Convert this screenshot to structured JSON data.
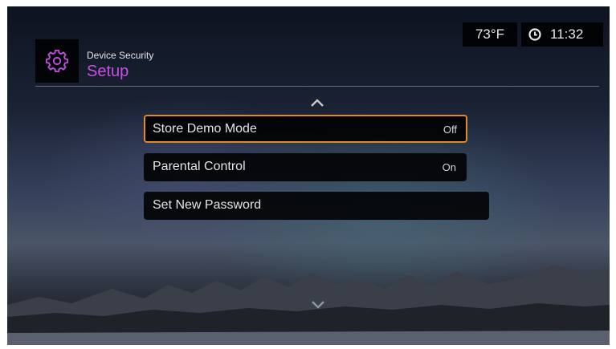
{
  "status": {
    "temperature": "73°F",
    "time": "11:32"
  },
  "header": {
    "subtitle": "Device Security",
    "title": "Setup",
    "icon": "gear-icon"
  },
  "menu": {
    "items": [
      {
        "label": "Store Demo Mode",
        "value": "Off",
        "selected": true
      },
      {
        "label": "Parental Control",
        "value": "On",
        "selected": false
      },
      {
        "label": "Set New Password",
        "value": "",
        "selected": false
      }
    ]
  },
  "colors": {
    "accent": "#c84fe6",
    "selection_border": "#e08a2a",
    "panel": "#000000"
  }
}
